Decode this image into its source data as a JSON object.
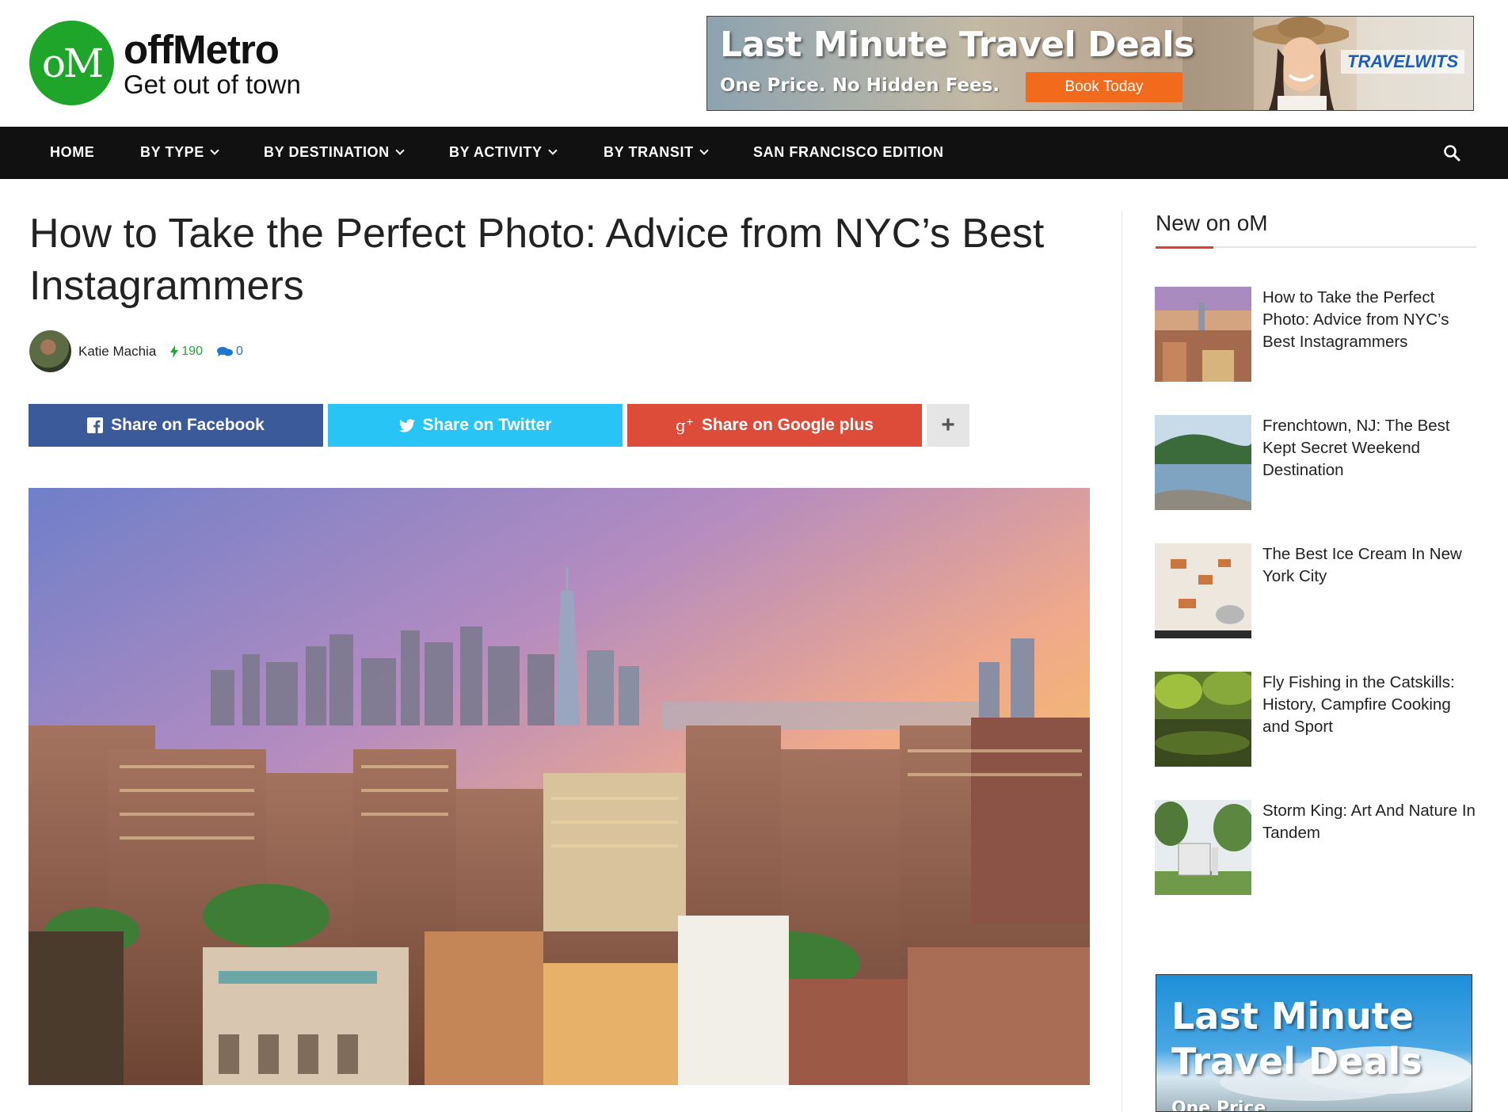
{
  "logo": {
    "mark": "oM",
    "name": "offMetro",
    "tagline": "Get out of town"
  },
  "header_ad": {
    "title": "Last Minute Travel Deals",
    "subtitle": "One Price. No Hidden Fees.",
    "button": "Book Today",
    "brand": "TRAVELWITS"
  },
  "nav": {
    "items": [
      {
        "label": "HOME",
        "dropdown": false
      },
      {
        "label": "BY TYPE",
        "dropdown": true
      },
      {
        "label": "BY DESTINATION",
        "dropdown": true
      },
      {
        "label": "BY ACTIVITY",
        "dropdown": true
      },
      {
        "label": "BY TRANSIT",
        "dropdown": true
      },
      {
        "label": "SAN FRANCISCO EDITION",
        "dropdown": false
      }
    ],
    "search_icon": "search-icon"
  },
  "article": {
    "title": "How to Take the Perfect Photo: Advice from NYC’s Best Instagrammers",
    "author": "Katie Machia",
    "views": "190",
    "comments": "0"
  },
  "share": {
    "facebook": "Share on Facebook",
    "twitter": "Share on Twitter",
    "google": "Share on Google plus",
    "more": "+"
  },
  "sidebar": {
    "title": "New on oM",
    "items": [
      {
        "title": "How to Take the Perfect Photo: Advice from NYC’s Best Instagrammers"
      },
      {
        "title": "Frenchtown, NJ: The Best Kept Secret Weekend Destination"
      },
      {
        "title": "The Best Ice Cream In New York City"
      },
      {
        "title": "Fly Fishing in the Catskills: History, Campfire Cooking and Sport"
      },
      {
        "title": "Storm King: Art And Nature In Tandem"
      }
    ],
    "ad": {
      "title_line1": "Last Minute",
      "title_line2": "Travel Deals",
      "subtitle": "One Price"
    }
  },
  "colors": {
    "nav_bg": "#111111",
    "facebook": "#3b5a9a",
    "twitter": "#28c4f6",
    "google": "#dd4b39",
    "accent_red": "#e03d35",
    "logo_green": "#1fa52a"
  }
}
